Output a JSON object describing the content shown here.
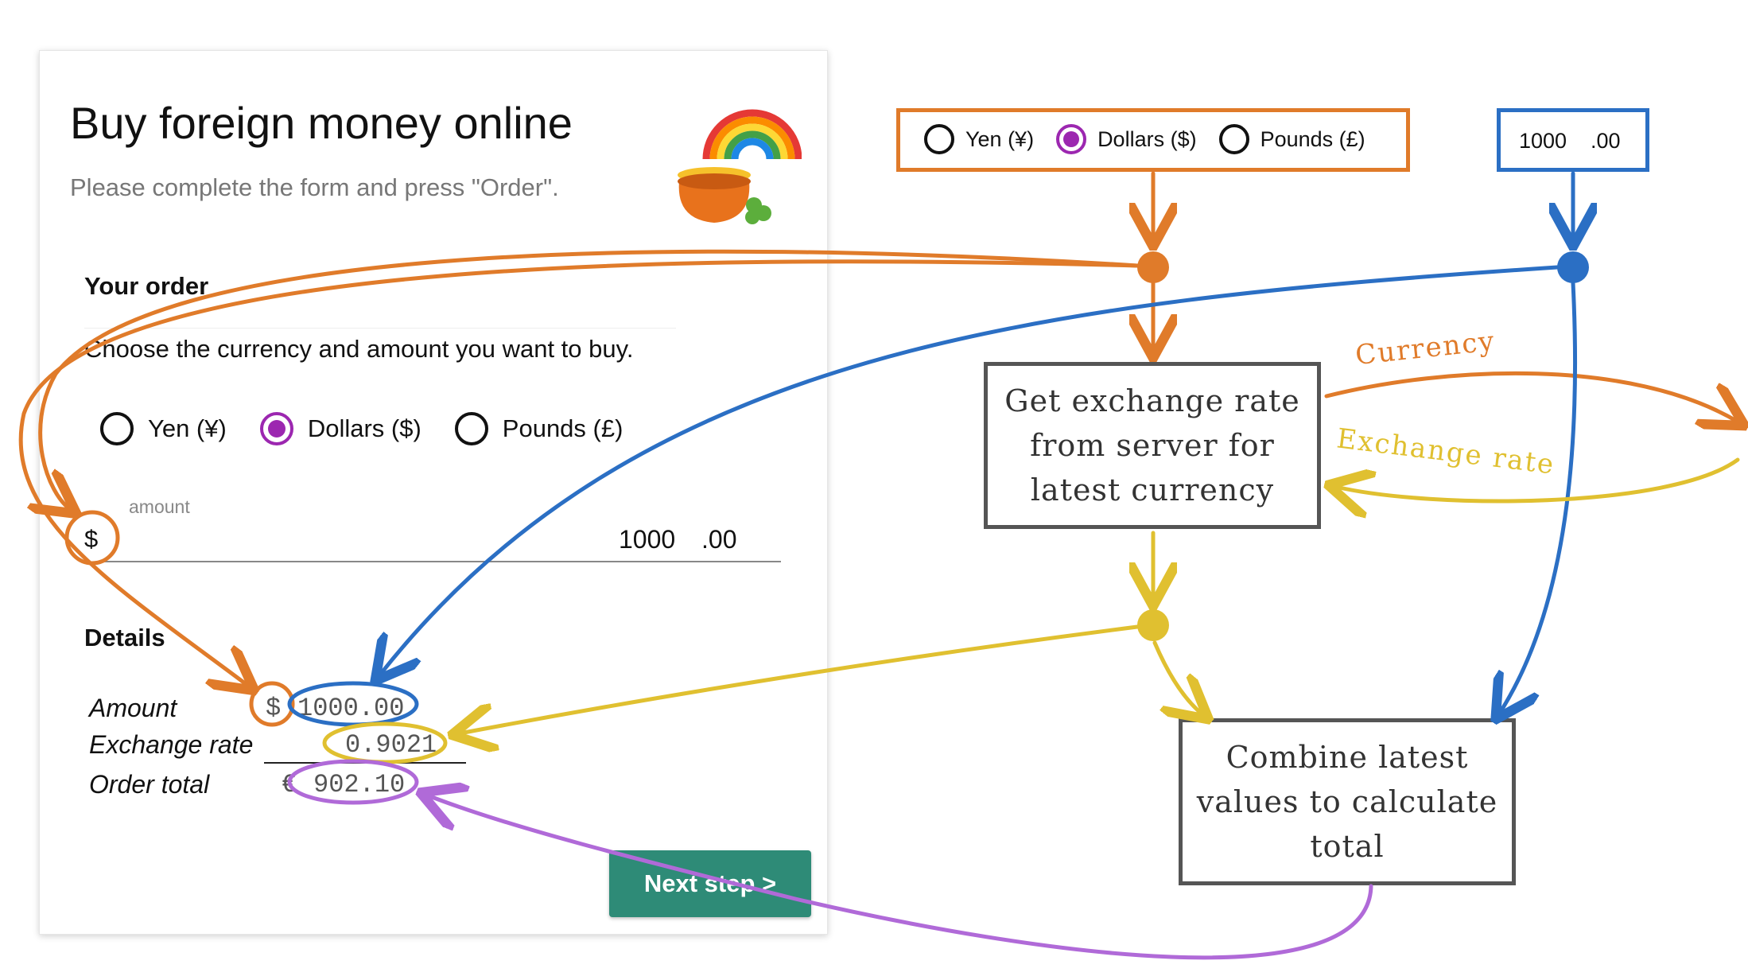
{
  "form": {
    "title": "Buy foreign money online",
    "subtitle": "Please complete the form and press \"Order\".",
    "order_heading": "Your order",
    "instructions": "Choose the currency and amount you want to buy.",
    "currencies": [
      {
        "label": "Yen (¥)",
        "selected": false
      },
      {
        "label": "Dollars ($)",
        "selected": true
      },
      {
        "label": "Pounds (£)",
        "selected": false
      }
    ],
    "amount_label": "amount",
    "currency_symbol": "$",
    "amount_integer": "1000",
    "amount_decimal": ".00",
    "details_heading": "Details",
    "details": {
      "amount_label": "Amount",
      "amount_symbol": "$",
      "amount_value": "1000.00",
      "rate_label": "Exchange rate",
      "rate_value": "0.9021",
      "total_label": "Order total",
      "total_symbol": "€",
      "total_value": "902.10"
    },
    "next_button": "Next step >"
  },
  "diagram": {
    "mini_currencies": [
      "Yen (¥)",
      "Dollars ($)",
      "Pounds (£)"
    ],
    "mini_amount_integer": "1000",
    "mini_amount_decimal": ".00",
    "box_exchange": [
      "Get exchange rate",
      "from server for",
      "latest currency"
    ],
    "box_combine": [
      "Combine latest",
      "values to calculate",
      "total"
    ],
    "label_currency": "Currency",
    "label_exchange_rate": "Exchange rate"
  },
  "colors": {
    "orange": "#e07b2a",
    "blue": "#2b6fc4",
    "yellow": "#e0c030",
    "purple": "#b06ad8",
    "button": "#2e8b77",
    "radio_selected": "#9c27b0"
  }
}
